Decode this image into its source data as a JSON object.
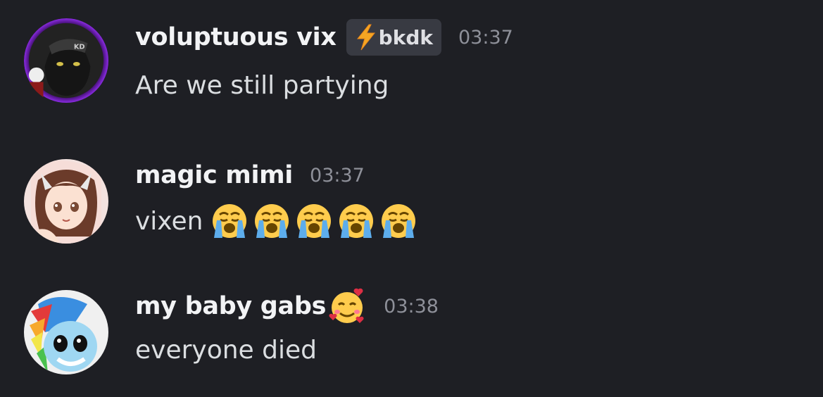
{
  "messages": [
    {
      "username": "voluptuous vix",
      "tag": {
        "icon": "lightning-bolt-icon",
        "label": "bkdk"
      },
      "timestamp": "03:37",
      "text": "Are we still partying",
      "avatar": "black-cat-avatar"
    },
    {
      "username": "magic mimi",
      "timestamp": "03:37",
      "text": "vixen",
      "emojis": [
        "loudly-crying-face",
        "loudly-crying-face",
        "loudly-crying-face",
        "loudly-crying-face",
        "loudly-crying-face"
      ],
      "avatar": "anime-girl-avatar"
    },
    {
      "username": "my baby gabs",
      "name_emoji": "smiling-face-with-hearts",
      "timestamp": "03:38",
      "text": "everyone died",
      "avatar": "pony-avatar"
    }
  ],
  "colors": {
    "background": "#1e1f24",
    "username": "#f2f3f5",
    "timestamp": "#8e9099",
    "message_text": "#dbdee1",
    "tag_background": "#383a42",
    "avatar_ring": "#7b2cff"
  }
}
